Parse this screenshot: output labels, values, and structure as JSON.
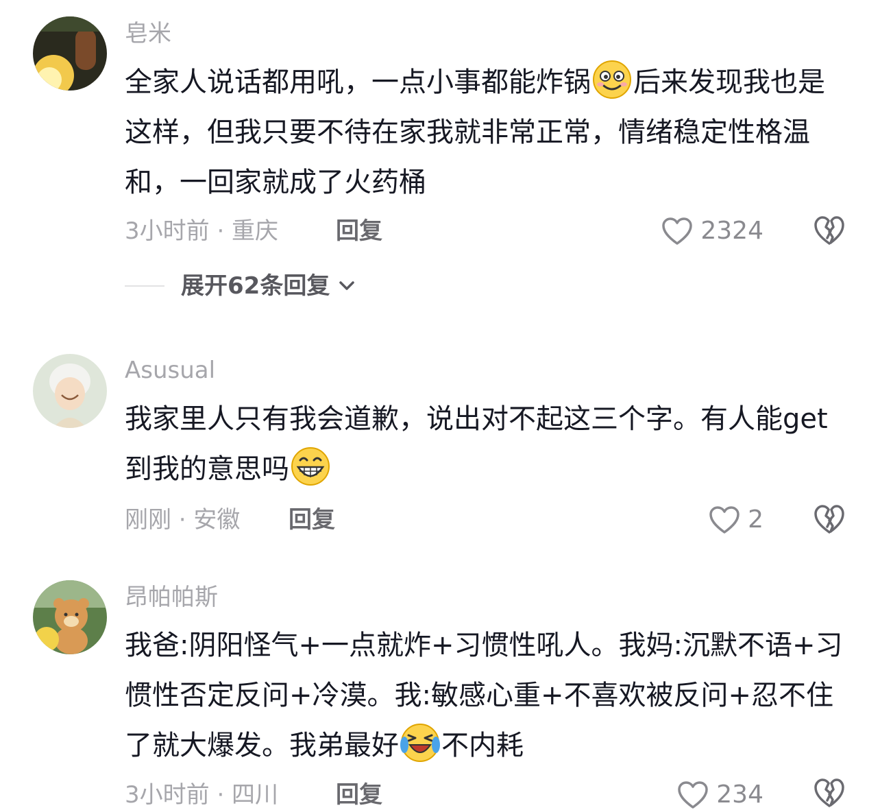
{
  "comments": [
    {
      "username": "皂米",
      "text_1": "全家人说话都用吼，一点小事都能炸锅",
      "emoji_1": "silly-face-emoji",
      "text_2": "后来发现我也是这样，但我只要不待在家我就非常正常，情绪稳定性格温和，一回家就成了火药桶",
      "meta": "3小时前 · 重庆",
      "reply_label": "回复",
      "likes": "2324",
      "expand_label": "展开62条回复"
    },
    {
      "username": "Asusual",
      "text_1": "我家里人只有我会道歉，说出对不起这三个字。有人能get到我的意思吗",
      "emoji_1": "grinning-teeth-emoji",
      "meta": "刚刚 · 安徽",
      "reply_label": "回复",
      "likes": "2"
    },
    {
      "username": "昂帕帕斯",
      "text_1": "我爸:阴阳怪气+一点就炸+习惯性吼人。我妈:沉默不语+习惯性否定反问+冷漠。我:敏感心重+不喜欢被反问+忍不住了就大爆发。我弟最好",
      "emoji_1": "laughing-crying-emoji",
      "text_2": "不内耗",
      "meta": "3小时前 · 四川",
      "reply_label": "回复",
      "likes": "234"
    }
  ],
  "colors": {
    "username": "#a6a6ab",
    "body_text": "#161823",
    "meta": "#a6a6ab",
    "reply": "#69696e"
  }
}
